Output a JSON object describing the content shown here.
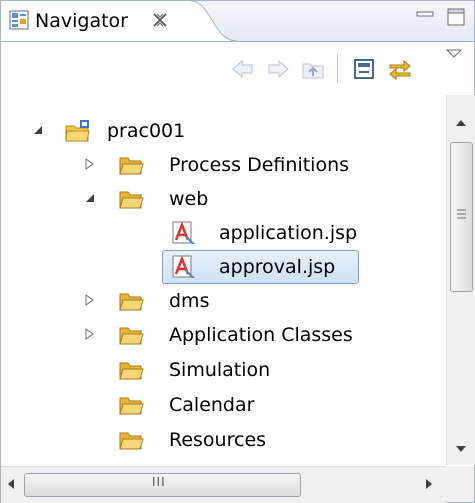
{
  "view": {
    "title": "Navigator",
    "close_glyph": "⊠"
  },
  "toolbar": {
    "icons": [
      "back-arrow-icon",
      "forward-arrow-icon",
      "up-folder-icon",
      "collapse-all-icon",
      "link-with-editor-icon",
      "view-menu-icon"
    ]
  },
  "tree": {
    "items": [
      {
        "label": "prac001",
        "type": "project",
        "expanded": true
      },
      {
        "label": "Process Definitions",
        "type": "folder",
        "expanded": false
      },
      {
        "label": "web",
        "type": "folder",
        "expanded": true
      },
      {
        "label": "application.jsp",
        "type": "jsp"
      },
      {
        "label": "approval.jsp",
        "type": "jsp",
        "selected": true
      },
      {
        "label": "dms",
        "type": "folder",
        "expanded": false
      },
      {
        "label": "Application Classes",
        "type": "folder",
        "expanded": false
      },
      {
        "label": "Simulation",
        "type": "folder"
      },
      {
        "label": "Calendar",
        "type": "folder"
      },
      {
        "label": "Resources",
        "type": "folder"
      }
    ]
  },
  "scrollbar": {
    "h_grip": "III"
  },
  "colors": {
    "folder": "#f2c64a",
    "selection_border": "#7da2ce",
    "border": "#a7b3c3"
  }
}
